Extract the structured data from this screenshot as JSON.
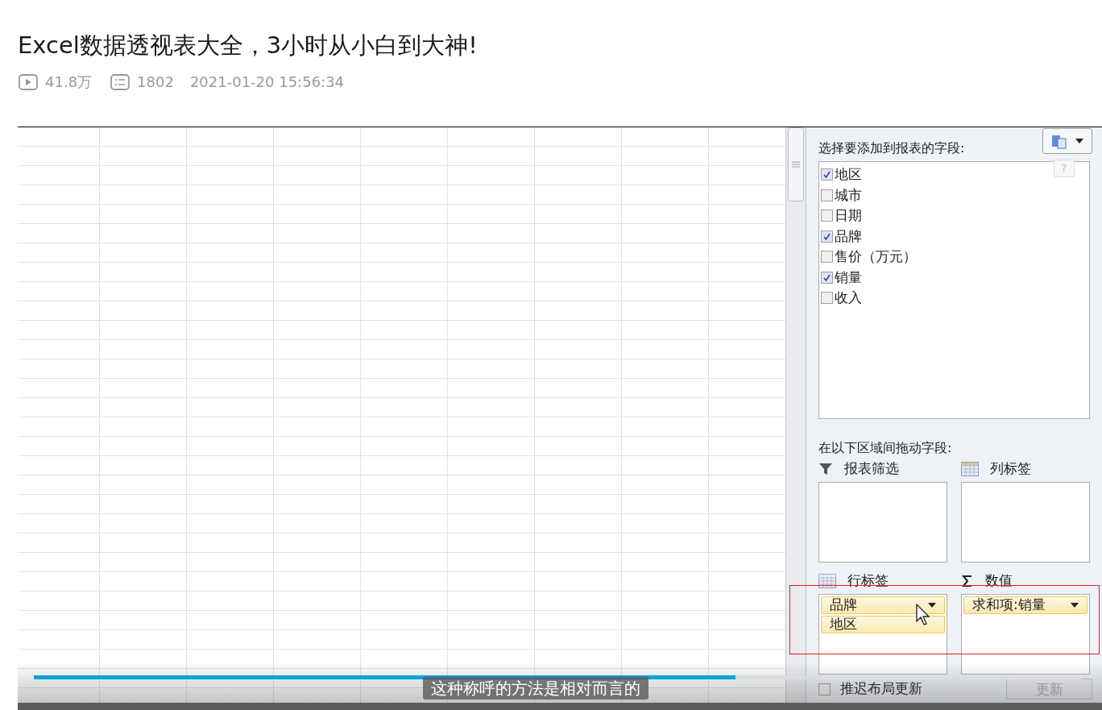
{
  "title": "Excel数据透视表大全，3小时从小白到大神!",
  "meta": {
    "views": "41.8万",
    "comments": "1802",
    "date": "2021-01-20 15:56:34"
  },
  "pivot_pane": {
    "field_list_label": "选择要添加到报表的字段:",
    "help": "?",
    "fields": [
      {
        "label": "地区",
        "checked": true
      },
      {
        "label": "城市",
        "checked": false
      },
      {
        "label": "日期",
        "checked": false
      },
      {
        "label": "品牌",
        "checked": true
      },
      {
        "label": "售价（万元）",
        "checked": false
      },
      {
        "label": "销量",
        "checked": true
      },
      {
        "label": "收入",
        "checked": false
      }
    ],
    "zones_label": "在以下区域间拖动字段:",
    "zones": [
      {
        "kind": "filter",
        "label": "报表筛选"
      },
      {
        "kind": "columns",
        "label": "列标签"
      },
      {
        "kind": "rows",
        "label": "行标签",
        "items": [
          "品牌",
          "地区"
        ]
      },
      {
        "kind": "values",
        "label": "数值",
        "items": [
          "求和项:销量"
        ]
      }
    ],
    "defer_update": {
      "label": "推迟布局更新",
      "checked": false
    },
    "update_button": {
      "label": "更新",
      "disabled": true
    }
  },
  "subtitle": "这种称呼的方法是相对而言的",
  "progress": {
    "level": 0.67
  }
}
